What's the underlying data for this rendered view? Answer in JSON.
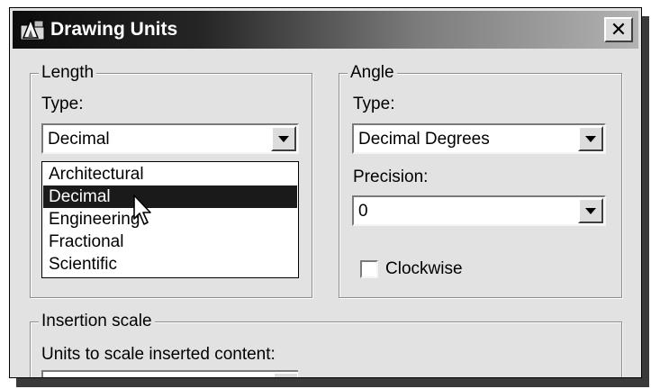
{
  "window": {
    "title": "Drawing Units",
    "close_glyph": "✕",
    "icon": "autocad-app-icon"
  },
  "length": {
    "group_label": "Length",
    "type_label": "Type:",
    "type_value": "Decimal",
    "options": [
      "Architectural",
      "Decimal",
      "Engineering",
      "Fractional",
      "Scientific"
    ],
    "highlighted_option": "Decimal"
  },
  "angle": {
    "group_label": "Angle",
    "type_label": "Type:",
    "type_value": "Decimal Degrees",
    "precision_label": "Precision:",
    "precision_value": "0",
    "clockwise_label": "Clockwise",
    "clockwise_checked": false
  },
  "insertion": {
    "group_label": "Insertion scale",
    "units_label": "Units to scale inserted content:"
  },
  "colors": {
    "dialog_bg": "#e2e2e2",
    "selection_bg": "#1a1a1a",
    "title_text": "#ffffff"
  }
}
